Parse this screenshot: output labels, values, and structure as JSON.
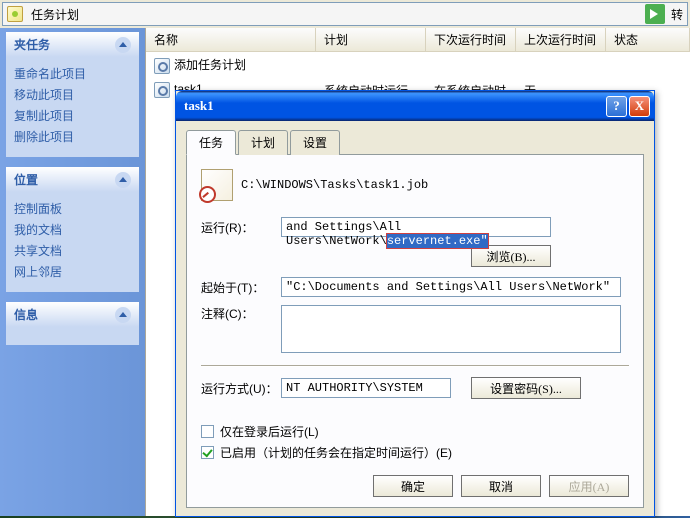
{
  "addressbar": {
    "text": "任务计划",
    "go": "转"
  },
  "sidebar": {
    "groups": [
      {
        "title": "夹任务",
        "items": [
          "重命名此项目",
          "移动此项目",
          "复制此项目",
          "删除此项目"
        ]
      },
      {
        "title": "位置",
        "items": [
          "控制面板",
          "我的文档",
          "共享文档",
          "网上邻居"
        ]
      },
      {
        "title": "信息",
        "items": []
      }
    ]
  },
  "list": {
    "cols": {
      "name": "名称",
      "plan": "计划",
      "next": "下次运行时间",
      "last": "上次运行时间",
      "state": "状态"
    },
    "rows": [
      {
        "name": "添加任务计划",
        "plan": "",
        "next": "",
        "last": "",
        "state": ""
      },
      {
        "name": "task1",
        "plan": "系统启动时运行",
        "next": "在系统启动时",
        "last": "无",
        "state": ""
      }
    ]
  },
  "dialog": {
    "title": "task1",
    "help": "?",
    "close": "X",
    "tabs": {
      "task": "任务",
      "plan": "计划",
      "settings": "设置"
    },
    "path": "C:\\WINDOWS\\Tasks\\task1.job",
    "labels": {
      "run": "运行(R)：",
      "browse": "浏览(B)...",
      "start_in": "起始于(T)：",
      "comment": "注释(C)：",
      "run_as": "运行方式(U)：",
      "set_pwd": "设置密码(S)...",
      "only_login": "仅在登录后运行(L)",
      "enabled": "已启用（计划的任务会在指定时间运行）(E)"
    },
    "values": {
      "run_prefix": "and Settings\\All Users\\NetWork\\",
      "run_sel": "servernet.exe\"",
      "start_in": "\"C:\\Documents and Settings\\All Users\\NetWork\"",
      "comment": "",
      "run_as": "NT AUTHORITY\\SYSTEM"
    },
    "buttons": {
      "ok": "确定",
      "cancel": "取消",
      "apply": "应用(A)"
    }
  }
}
